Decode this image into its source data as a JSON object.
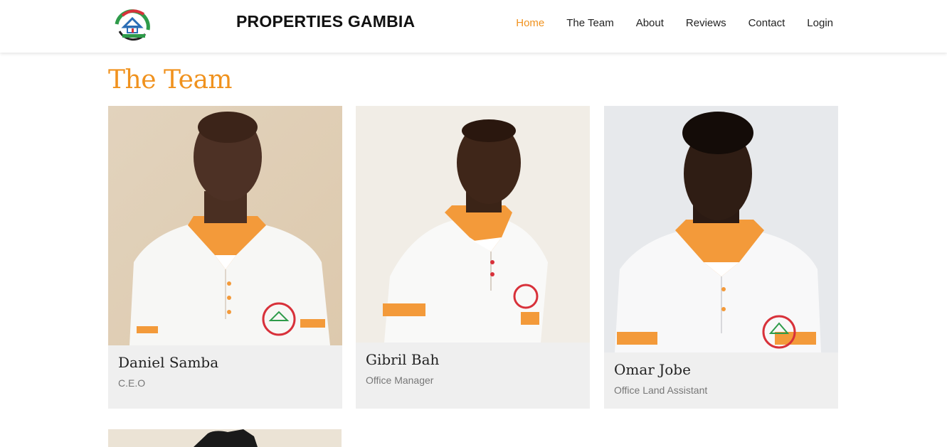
{
  "header": {
    "brand": "PROPERTIES GAMBIA",
    "logo_icon": "house-logo-icon",
    "nav": [
      {
        "label": "Home",
        "active": true
      },
      {
        "label": "The Team",
        "active": false
      },
      {
        "label": "About",
        "active": false
      },
      {
        "label": "Reviews",
        "active": false
      },
      {
        "label": "Contact",
        "active": false
      },
      {
        "label": "Login",
        "active": false
      }
    ]
  },
  "colors": {
    "accent": "#f0921e",
    "card_bg": "#efefef",
    "shirt_orange": "#f39a3a"
  },
  "main": {
    "title": "The Team",
    "members": [
      {
        "name": "Daniel Samba",
        "role": "C.E.O"
      },
      {
        "name": "Gibril Bah",
        "role": "Office Manager"
      },
      {
        "name": "Omar Jobe",
        "role": "Office Land Assistant"
      }
    ]
  }
}
